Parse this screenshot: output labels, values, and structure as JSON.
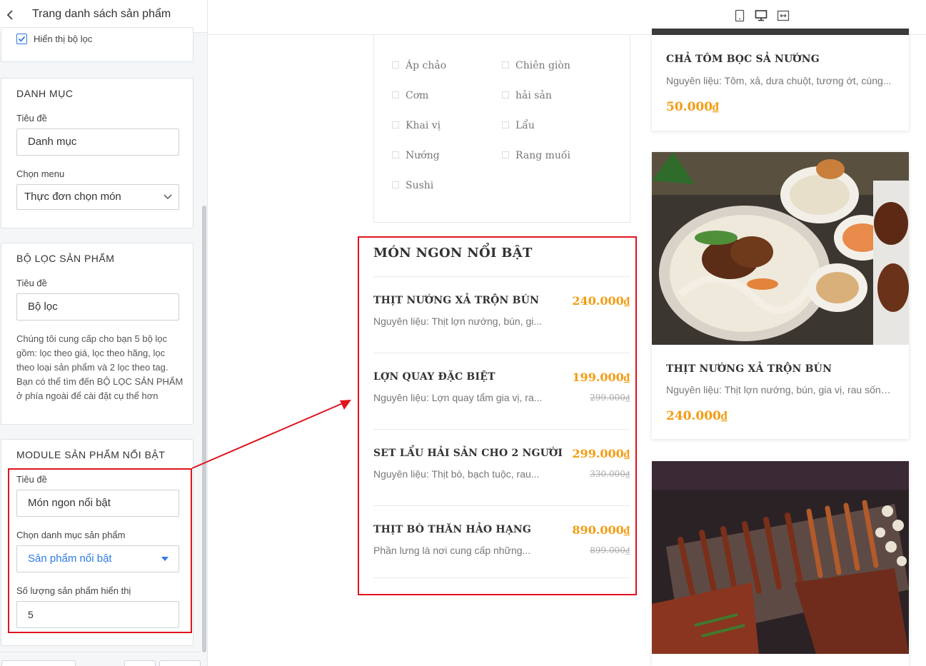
{
  "panel": {
    "title": "Trang danh sách sản phẩm",
    "show_filter_label": "Hiển thị bộ lọc",
    "show_filter_checked": true,
    "category": {
      "heading": "DANH MỤC",
      "title_label": "Tiêu đề",
      "title_value": "Danh mục",
      "menu_label": "Chọn menu",
      "menu_value": "Thực đơn chọn món"
    },
    "product_filter": {
      "heading": "BỘ LỌC SẢN PHẨM",
      "title_label": "Tiêu đề",
      "title_value": "Bộ lọc",
      "help": "Chúng tôi cung cấp cho bạn 5 bộ lọc gồm: lọc theo giá, lọc theo hãng, lọc theo loại sản phẩm và 2 lọc theo tag. Bạn có thể tìm đến BỘ LỌC SẢN PHẨM ở phía ngoài để cài đặt cụ thể hơn"
    },
    "featured_module": {
      "heading": "MODULE SẢN PHẨM NỔI BẬT",
      "title_label": "Tiêu đề",
      "title_value": "Món ngon nổi bật",
      "category_label": "Chọn danh mục sản phẩm",
      "category_value": "Sản phẩm nổi bật",
      "count_label": "Số lượng sản phẩm hiển thị",
      "count_value": "5"
    }
  },
  "device_switcher": {
    "icons": [
      "mobile-icon",
      "desktop-icon",
      "fullwidth-icon"
    ],
    "active": "desktop-icon"
  },
  "preview": {
    "filter_items": [
      "Áp chảo",
      "Chiên giòn",
      "Cơm",
      "hải sản",
      "Khai vị",
      "Lẩu",
      "Nướng",
      "Rang muối",
      "Sushi"
    ],
    "featured": {
      "title": "MÓN NGON NỔI BẬT",
      "items": [
        {
          "name": "THỊT NƯỚNG XẢ TRỘN BÚN",
          "desc": "Nguyên liệu: Thịt lợn nướng, bún, gi...",
          "price": "240.000₫",
          "old_price": ""
        },
        {
          "name": "LỢN QUAY ĐẶC BIỆT",
          "desc": "Nguyên liệu: Lợn quay tẩm gia vị, ra...",
          "price": "199.000₫",
          "old_price": "299.000₫"
        },
        {
          "name": "SET LẨU HẢI SẢN CHO 2 NGƯỜI",
          "desc": "Nguyên liệu: Thịt bò, bạch tuộc, rau...",
          "price": "299.000₫",
          "old_price": "330.000₫"
        },
        {
          "name": "THỊT BÒ THĂN HẢO HẠNG",
          "desc": "Phần lưng là nơi cung cấp những...",
          "price": "890.000₫",
          "old_price": "899.000₫"
        }
      ]
    },
    "products": [
      {
        "name": "CHẢ TÔM BỌC SẢ NƯỚNG",
        "desc": "Nguyên liệu: Tôm, xả, dưa chuột, tương ớt, cùng...",
        "price": "50.000₫"
      },
      {
        "name": "THỊT NƯỚNG XẢ TRỘN BÚN",
        "desc": "Nguyên liệu: Thịt lợn nướng, bún, gia vị, rau sống...",
        "price": "240.000₫"
      }
    ]
  },
  "colors": {
    "accent": "#2c7be5",
    "price": "#f39c12",
    "annotation": "#e0141e"
  }
}
